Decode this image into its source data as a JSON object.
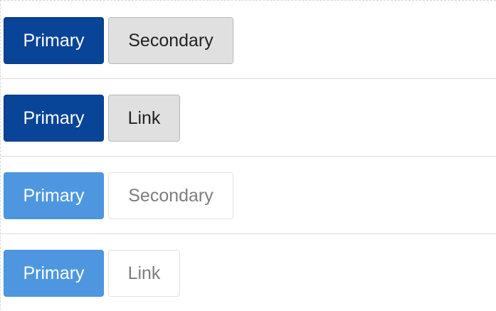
{
  "rows": [
    {
      "primary_label": "Primary",
      "secondary_label": "Secondary"
    },
    {
      "primary_label": "Primary",
      "secondary_label": "Link"
    },
    {
      "primary_label": "Primary",
      "secondary_label": "Secondary"
    },
    {
      "primary_label": "Primary",
      "secondary_label": "Link"
    }
  ],
  "colors": {
    "primary_dark": "#084497",
    "primary_light": "#4e97e0",
    "secondary_gray": "#e0e0e0",
    "secondary_white": "#ffffff",
    "text_light": "#ffffff",
    "text_dark": "#222222",
    "text_muted": "#7d7d7d"
  }
}
